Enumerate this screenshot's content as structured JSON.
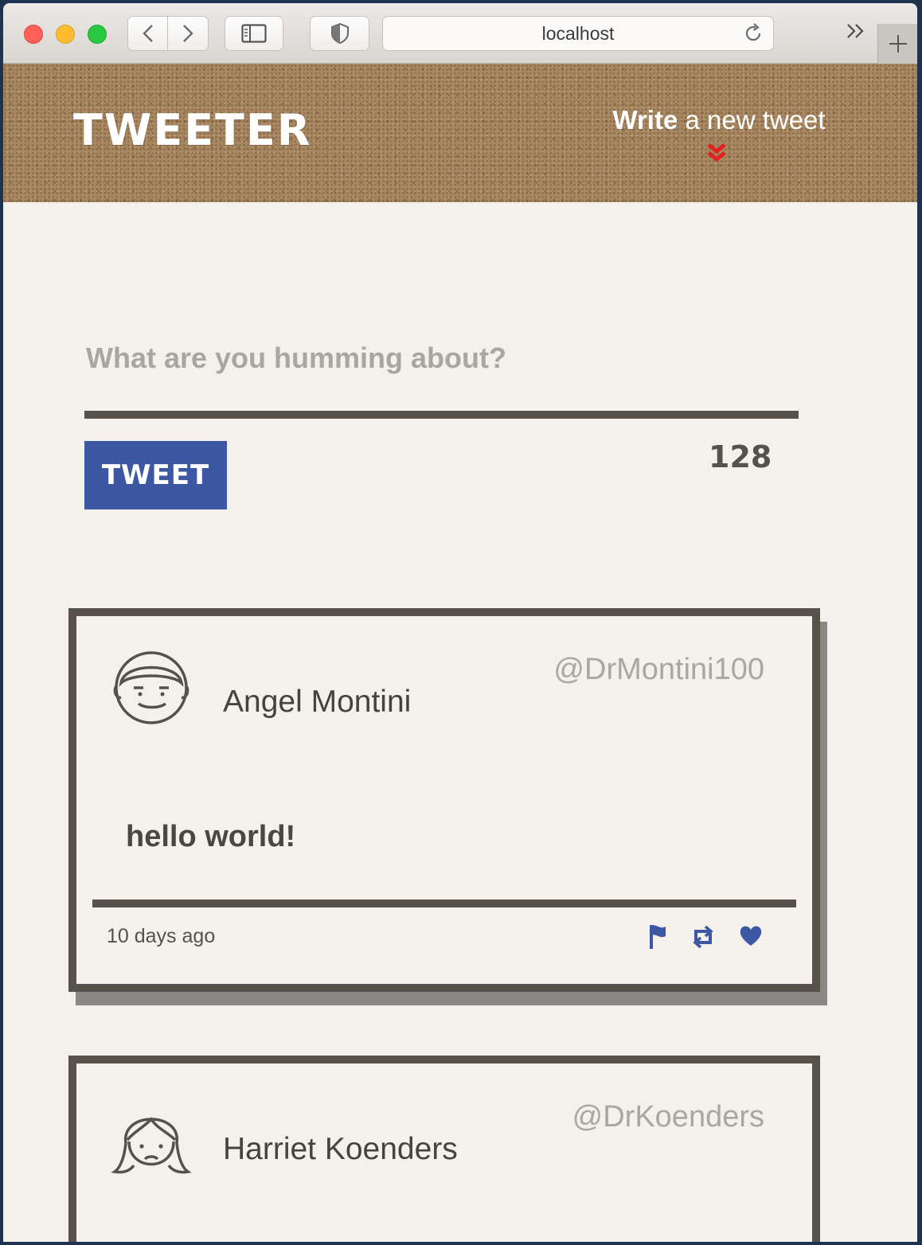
{
  "browser": {
    "address": "localhost",
    "icons": [
      "back-icon",
      "forward-icon",
      "sidebar-icon",
      "shield-icon",
      "reload-icon",
      "overflow-icon",
      "plus-icon"
    ]
  },
  "header": {
    "logo": "TWEETER",
    "compose_bold": "Write",
    "compose_rest": " a new tweet",
    "arrow_color": "#e0231f"
  },
  "compose": {
    "placeholder": "What are you humming about?",
    "button_label": "TWEET",
    "button_color": "#3d58a3",
    "counter": "128"
  },
  "tweets": [
    {
      "name": "Angel Montini",
      "handle": "@DrMontini100",
      "text": "hello world!",
      "time": "10 days ago",
      "action_color": "#3d58a3"
    },
    {
      "name": "Harriet Koenders",
      "handle": "@DrKoenders"
    }
  ]
}
